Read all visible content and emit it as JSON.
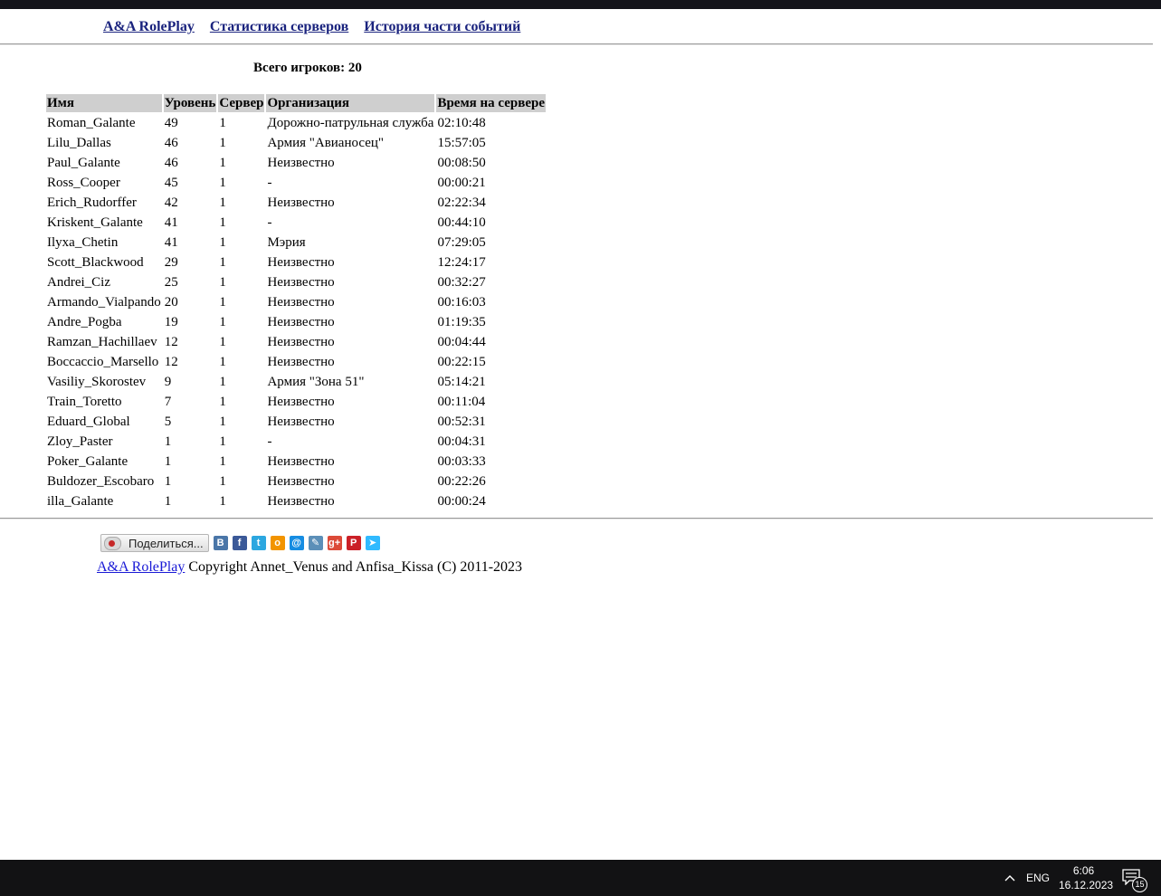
{
  "nav": {
    "links": [
      {
        "label": "A&A RolePlay"
      },
      {
        "label": "Статистика серверов"
      },
      {
        "label": "История части событий"
      }
    ]
  },
  "summary": {
    "total_players": "Всего игроков: 20"
  },
  "table": {
    "headers": [
      "Имя",
      "Уровень",
      "Сервер",
      "Организация",
      "Время на сервере"
    ],
    "rows": [
      [
        "Roman_Galante",
        "49",
        "1",
        "Дорожно-патрульная служба",
        "02:10:48"
      ],
      [
        "Lilu_Dallas",
        "46",
        "1",
        "Армия \"Авианосец\"",
        "15:57:05"
      ],
      [
        "Paul_Galante",
        "46",
        "1",
        "Неизвестно",
        "00:08:50"
      ],
      [
        "Ross_Cooper",
        "45",
        "1",
        "-",
        "00:00:21"
      ],
      [
        "Erich_Rudorffer",
        "42",
        "1",
        "Неизвестно",
        "02:22:34"
      ],
      [
        "Kriskent_Galante",
        "41",
        "1",
        "-",
        "00:44:10"
      ],
      [
        "Ilyxa_Chetin",
        "41",
        "1",
        "Мэрия",
        "07:29:05"
      ],
      [
        "Scott_Blackwood",
        "29",
        "1",
        "Неизвестно",
        "12:24:17"
      ],
      [
        "Andrei_Ciz",
        "25",
        "1",
        "Неизвестно",
        "00:32:27"
      ],
      [
        "Armando_Vialpando",
        "20",
        "1",
        "Неизвестно",
        "00:16:03"
      ],
      [
        "Andre_Pogba",
        "19",
        "1",
        "Неизвестно",
        "01:19:35"
      ],
      [
        "Ramzan_Hachillaev",
        "12",
        "1",
        "Неизвестно",
        "00:04:44"
      ],
      [
        "Boccaccio_Marsello",
        "12",
        "1",
        "Неизвестно",
        "00:22:15"
      ],
      [
        "Vasiliy_Skorostev",
        "9",
        "1",
        "Армия \"Зона 51\"",
        "05:14:21"
      ],
      [
        "Train_Toretto",
        "7",
        "1",
        "Неизвестно",
        "00:11:04"
      ],
      [
        "Eduard_Global",
        "5",
        "1",
        "Неизвестно",
        "00:52:31"
      ],
      [
        "Zloy_Paster",
        "1",
        "1",
        "-",
        "00:04:31"
      ],
      [
        "Poker_Galante",
        "1",
        "1",
        "Неизвестно",
        "00:03:33"
      ],
      [
        "Buldozer_Escobaro",
        "1",
        "1",
        "Неизвестно",
        "00:22:26"
      ],
      [
        "illa_Galante",
        "1",
        "1",
        "Неизвестно",
        "00:00:24"
      ]
    ]
  },
  "share": {
    "button_label": "Поделиться...",
    "networks": [
      {
        "icon": "vk-icon",
        "glyph": "B",
        "color": "#4a76a8"
      },
      {
        "icon": "facebook-icon",
        "glyph": "f",
        "color": "#3b5998"
      },
      {
        "icon": "twitter-icon",
        "glyph": "t",
        "color": "#2ca7e0"
      },
      {
        "icon": "odnoklassniki-icon",
        "glyph": "о",
        "color": "#f29400"
      },
      {
        "icon": "mailru-icon",
        "glyph": "@",
        "color": "#168de2"
      },
      {
        "icon": "livejournal-icon",
        "glyph": "✎",
        "color": "#5c8fb8"
      },
      {
        "icon": "googleplus-icon",
        "glyph": "g+",
        "color": "#dc4a38"
      },
      {
        "icon": "pinterest-icon",
        "glyph": "P",
        "color": "#cb2027"
      },
      {
        "icon": "surfingbird-icon",
        "glyph": "➤",
        "color": "#30baff"
      }
    ]
  },
  "footer": {
    "link_label": "A&A RolePlay",
    "copyright": " Copyright Annet_Venus and Anfisa_Kissa (C) 2011-2023"
  },
  "taskbar": {
    "language": "ENG",
    "time": "6:06",
    "date": "16.12.2023",
    "notification_count": "15"
  }
}
